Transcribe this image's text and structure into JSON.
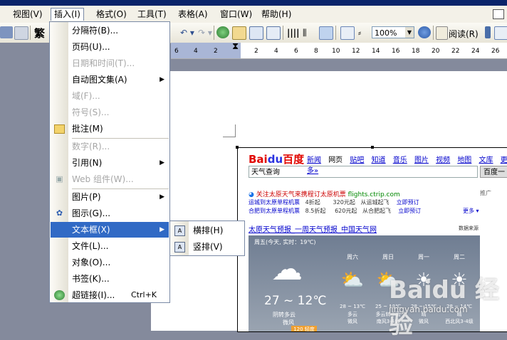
{
  "menubar": {
    "items": [
      "视图(V)",
      "插入(I)",
      "格式(O)",
      "工具(T)",
      "表格(A)",
      "窗口(W)",
      "帮助(H)"
    ]
  },
  "toolbar": {
    "fanti_label": "繁",
    "zoom_value": "100%",
    "read_label": "阅读(R)"
  },
  "ruler": {
    "left_ticks": [
      "6",
      "4",
      "2"
    ],
    "right_ticks": [
      "2",
      "4",
      "6",
      "8",
      "10",
      "12",
      "14",
      "16",
      "18",
      "20",
      "22",
      "24",
      "26"
    ]
  },
  "insert_menu": {
    "items": [
      {
        "label": "分隔符(B)...",
        "enabled": true
      },
      {
        "label": "页码(U)...",
        "enabled": true
      },
      {
        "label": "日期和时间(T)...",
        "enabled": false
      },
      {
        "label": "自动图文集(A)",
        "enabled": true,
        "submenu": true
      },
      {
        "label": "域(F)...",
        "enabled": false
      },
      {
        "label": "符号(S)...",
        "enabled": false
      },
      {
        "label": "批注(M)",
        "enabled": true,
        "icon": "comment-icon"
      },
      {
        "label": "数字(R)...",
        "enabled": false
      },
      {
        "label": "引用(N)",
        "enabled": true,
        "submenu": true
      },
      {
        "label": "Web 组件(W)...",
        "enabled": false,
        "icon": "web-component-icon"
      },
      {
        "label": "图片(P)",
        "enabled": true,
        "submenu": true
      },
      {
        "label": "图示(G)...",
        "enabled": true,
        "icon": "diagram-icon"
      },
      {
        "label": "文本框(X)",
        "enabled": true,
        "submenu": true,
        "highlighted": true
      },
      {
        "label": "文件(L)...",
        "enabled": true
      },
      {
        "label": "对象(O)...",
        "enabled": true
      },
      {
        "label": "书签(K)...",
        "enabled": true
      },
      {
        "label": "超链接(I)...",
        "enabled": true,
        "shortcut": "Ctrl+K",
        "icon": "hyperlink-icon"
      }
    ]
  },
  "textbox_submenu": {
    "items": [
      "横排(H)",
      "竖排(V)"
    ]
  },
  "web": {
    "logo_bai": "Bai",
    "logo_du": "du",
    "logo_cn": "百度",
    "nav": [
      "新闻",
      "网页",
      "贴吧",
      "知道",
      "音乐",
      "图片",
      "视频",
      "地图",
      "文库",
      "更多»"
    ],
    "search_query": "天气查询",
    "search_button": "百度一",
    "ad_title": "关注太原天气来携程订太原机票",
    "ad_domain": "flights.ctrip.com",
    "ad_right": "推广",
    "ad_rows": [
      [
        "运城到太原单程机票",
        "4折起",
        "320元起",
        "从运城起飞",
        "立即预订"
      ],
      [
        "合肥到太原单程机票",
        "8.5折起",
        "620元起",
        "从合肥起飞",
        "立即预订"
      ]
    ],
    "ad_more": "更多 ▾",
    "weather_title": "太原天气预报_一周天气预报_中国天气网",
    "weather_source": "数据来源",
    "weather_header": "周五(今天, 实时：19℃)",
    "today_temp": "27 ~ 12℃",
    "today_desc": "阴转多云",
    "today_wind": "微风",
    "today_aqi": "120 轻度",
    "days": [
      {
        "name": "周六",
        "temp": "28 ~ 13℃",
        "desc": "多云",
        "wind": "微风"
      },
      {
        "name": "周日",
        "temp": "25 ~ 13℃",
        "desc": "多云转小雨",
        "wind": "南风3-4级"
      },
      {
        "name": "周一",
        "temp": "28 ~ 15℃",
        "desc": "晴",
        "wind": "微风"
      },
      {
        "name": "周二",
        "temp": "28 ~ 14℃",
        "desc": "晴",
        "wind": "西北风3-4级"
      }
    ]
  },
  "watermark": {
    "brand": "Baidu 经验",
    "url": "jingyan.baidu.com"
  }
}
